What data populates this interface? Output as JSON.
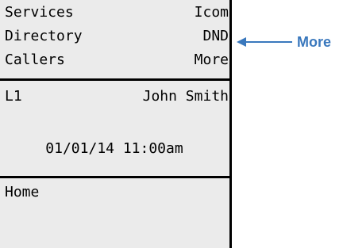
{
  "softkeys": {
    "left": [
      "Services",
      "Directory",
      "Callers"
    ],
    "right": [
      "Icom",
      "DND",
      "More"
    ]
  },
  "line": {
    "key": "L1",
    "name": "John Smith"
  },
  "datetime": "01/01/14 11:00am",
  "home_label": "Home",
  "callout": {
    "label": "More",
    "color": "#3a78bd"
  }
}
